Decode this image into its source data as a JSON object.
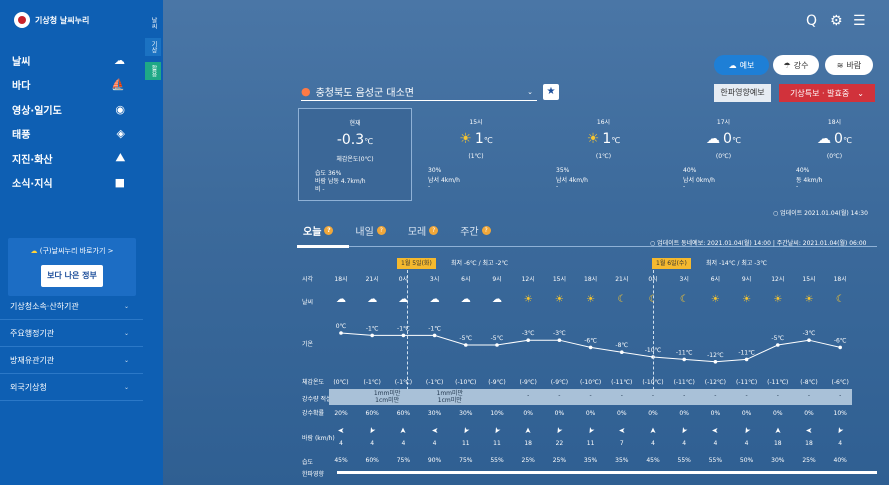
{
  "logo": {
    "text": "기상청 날씨누리"
  },
  "sidebar": {
    "items": [
      {
        "label": "날씨",
        "icon": "cloud-sun-icon"
      },
      {
        "label": "바다",
        "icon": "wave-icon"
      },
      {
        "label": "영상·일기도",
        "icon": "globe-icon"
      },
      {
        "label": "태풍",
        "icon": "typhoon-icon"
      },
      {
        "label": "지진·화산",
        "icon": "volcano-icon"
      },
      {
        "label": "소식·지식",
        "icon": "book-icon"
      }
    ],
    "banner": {
      "title": "(구)날씨누리 바로가기 >",
      "tagline": "보다 나은 정부"
    },
    "links": [
      {
        "label": "기상청소속·산하기관"
      },
      {
        "label": "주요행정기관"
      },
      {
        "label": "방재유관기관"
      },
      {
        "label": "외국기상청"
      }
    ]
  },
  "strip": {
    "tabs": [
      "날씨",
      "기상",
      "활용"
    ]
  },
  "toolbar": {
    "search": "Q",
    "settings": "⚙",
    "menu": "☰"
  },
  "modes": {
    "forecast": "예보",
    "precip": "강수",
    "wind": "바람"
  },
  "location": {
    "value": "충청북도 음성군 대소면"
  },
  "buttons": {
    "coldwave": "한파영향예보",
    "warning": "기상특보 · 발효중"
  },
  "cards": [
    {
      "time": "현재",
      "temp": "-0.3",
      "unit": "℃",
      "feel": "체감온도(0℃)",
      "l1": "습도 36%",
      "l2": "바람 남동 4.7km/h",
      "l3": "비 -",
      "icon": "none"
    },
    {
      "time": "15시",
      "temp": "1",
      "unit": "℃",
      "feel": "(1℃)",
      "l1": "30%",
      "l2": "남서 4km/h",
      "l3": "-",
      "icon": "sun"
    },
    {
      "time": "16시",
      "temp": "1",
      "unit": "℃",
      "feel": "(1℃)",
      "l1": "35%",
      "l2": "남서 4km/h",
      "l3": "-",
      "icon": "sun"
    },
    {
      "time": "17시",
      "temp": "0",
      "unit": "℃",
      "feel": "(0℃)",
      "l1": "40%",
      "l2": "남서 0km/h",
      "l3": "-",
      "icon": "cloud"
    },
    {
      "time": "18시",
      "temp": "0",
      "unit": "℃",
      "feel": "(0℃)",
      "l1": "40%",
      "l2": "동 4km/h",
      "l3": "-",
      "icon": "cloud"
    }
  ],
  "update1": "업데이트 2021.01.04(월) 14:30",
  "tabs": [
    "오늘",
    "내일",
    "모레",
    "주간"
  ],
  "update2": "업데이트 동네예보: 2021.01.04(월) 14:00 | 주간날씨: 2021.01.04(월) 06:00",
  "days": [
    {
      "tag": "1월 5일(화)",
      "range": "최저 -6℃ / 최고 -2℃"
    },
    {
      "tag": "1월 6일(수)",
      "range": "최저 -14℃ / 최고 -3℃"
    }
  ],
  "rows": {
    "time": "시각",
    "weather": "날씨",
    "temp": "기온",
    "feel": "체감온도",
    "precip": "강수량 적설",
    "prob": "강수확률",
    "wind": "바람 (km/h)",
    "hum": "습도",
    "cold": "한파영향"
  },
  "hours": [
    "18시",
    "21시",
    "0시",
    "3시",
    "6시",
    "9시",
    "12시",
    "15시",
    "18시",
    "21시",
    "0시",
    "3시",
    "6시",
    "9시",
    "12시",
    "15시",
    "18시"
  ],
  "icons": [
    "cloud-sun",
    "cloud",
    "cloud",
    "cloud",
    "cloud",
    "cloud",
    "sun",
    "sun",
    "sun",
    "moon",
    "moon",
    "moon",
    "sun",
    "sun",
    "sun",
    "sun",
    "moon"
  ],
  "temps": [
    0,
    -1,
    -1,
    -1,
    -5,
    -5,
    -3,
    -3,
    -6,
    -8,
    -10,
    -11,
    -12,
    -11,
    -5,
    -3,
    -6
  ],
  "temp_labels": [
    "0℃",
    "-1℃",
    "-1℃",
    "-1℃",
    "-5℃",
    "-5℃",
    "-3℃",
    "-3℃",
    "-6℃",
    "-8℃",
    "-10℃",
    "-11℃",
    "-12℃",
    "-11℃",
    "-5℃",
    "-3℃",
    "-6℃"
  ],
  "feels": [
    "(0℃)",
    "(-1℃)",
    "(-1℃)",
    "(-1℃)",
    "(-10℃)",
    "(-9℃)",
    "(-9℃)",
    "(-9℃)",
    "(-10℃)",
    "(-11℃)",
    "(-10℃)",
    "(-11℃)",
    "(-12℃)",
    "(-11℃)",
    "(-11℃)",
    "(-8℃)",
    "(-6℃)"
  ],
  "precip": {
    "a": "1mm미만 1cm미만",
    "b": "1mm미만 1cm미만",
    "dashes": [
      "-",
      "-",
      "-",
      "-",
      "-",
      "-",
      "-",
      "-",
      "-",
      "-",
      "-"
    ]
  },
  "probs": [
    "20%",
    "60%",
    "60%",
    "30%",
    "30%",
    "10%",
    "0%",
    "0%",
    "0%",
    "0%",
    "0%",
    "0%",
    "0%",
    "0%",
    "0%",
    "0%",
    "10%"
  ],
  "winds": [
    "4",
    "4",
    "4",
    "4",
    "11",
    "11",
    "18",
    "22",
    "11",
    "7",
    "4",
    "4",
    "4",
    "4",
    "18",
    "18",
    "4"
  ],
  "hums": [
    "45%",
    "60%",
    "75%",
    "90%",
    "75%",
    "55%",
    "25%",
    "25%",
    "35%",
    "35%",
    "45%",
    "55%",
    "55%",
    "50%",
    "30%",
    "25%",
    "40%"
  ]
}
